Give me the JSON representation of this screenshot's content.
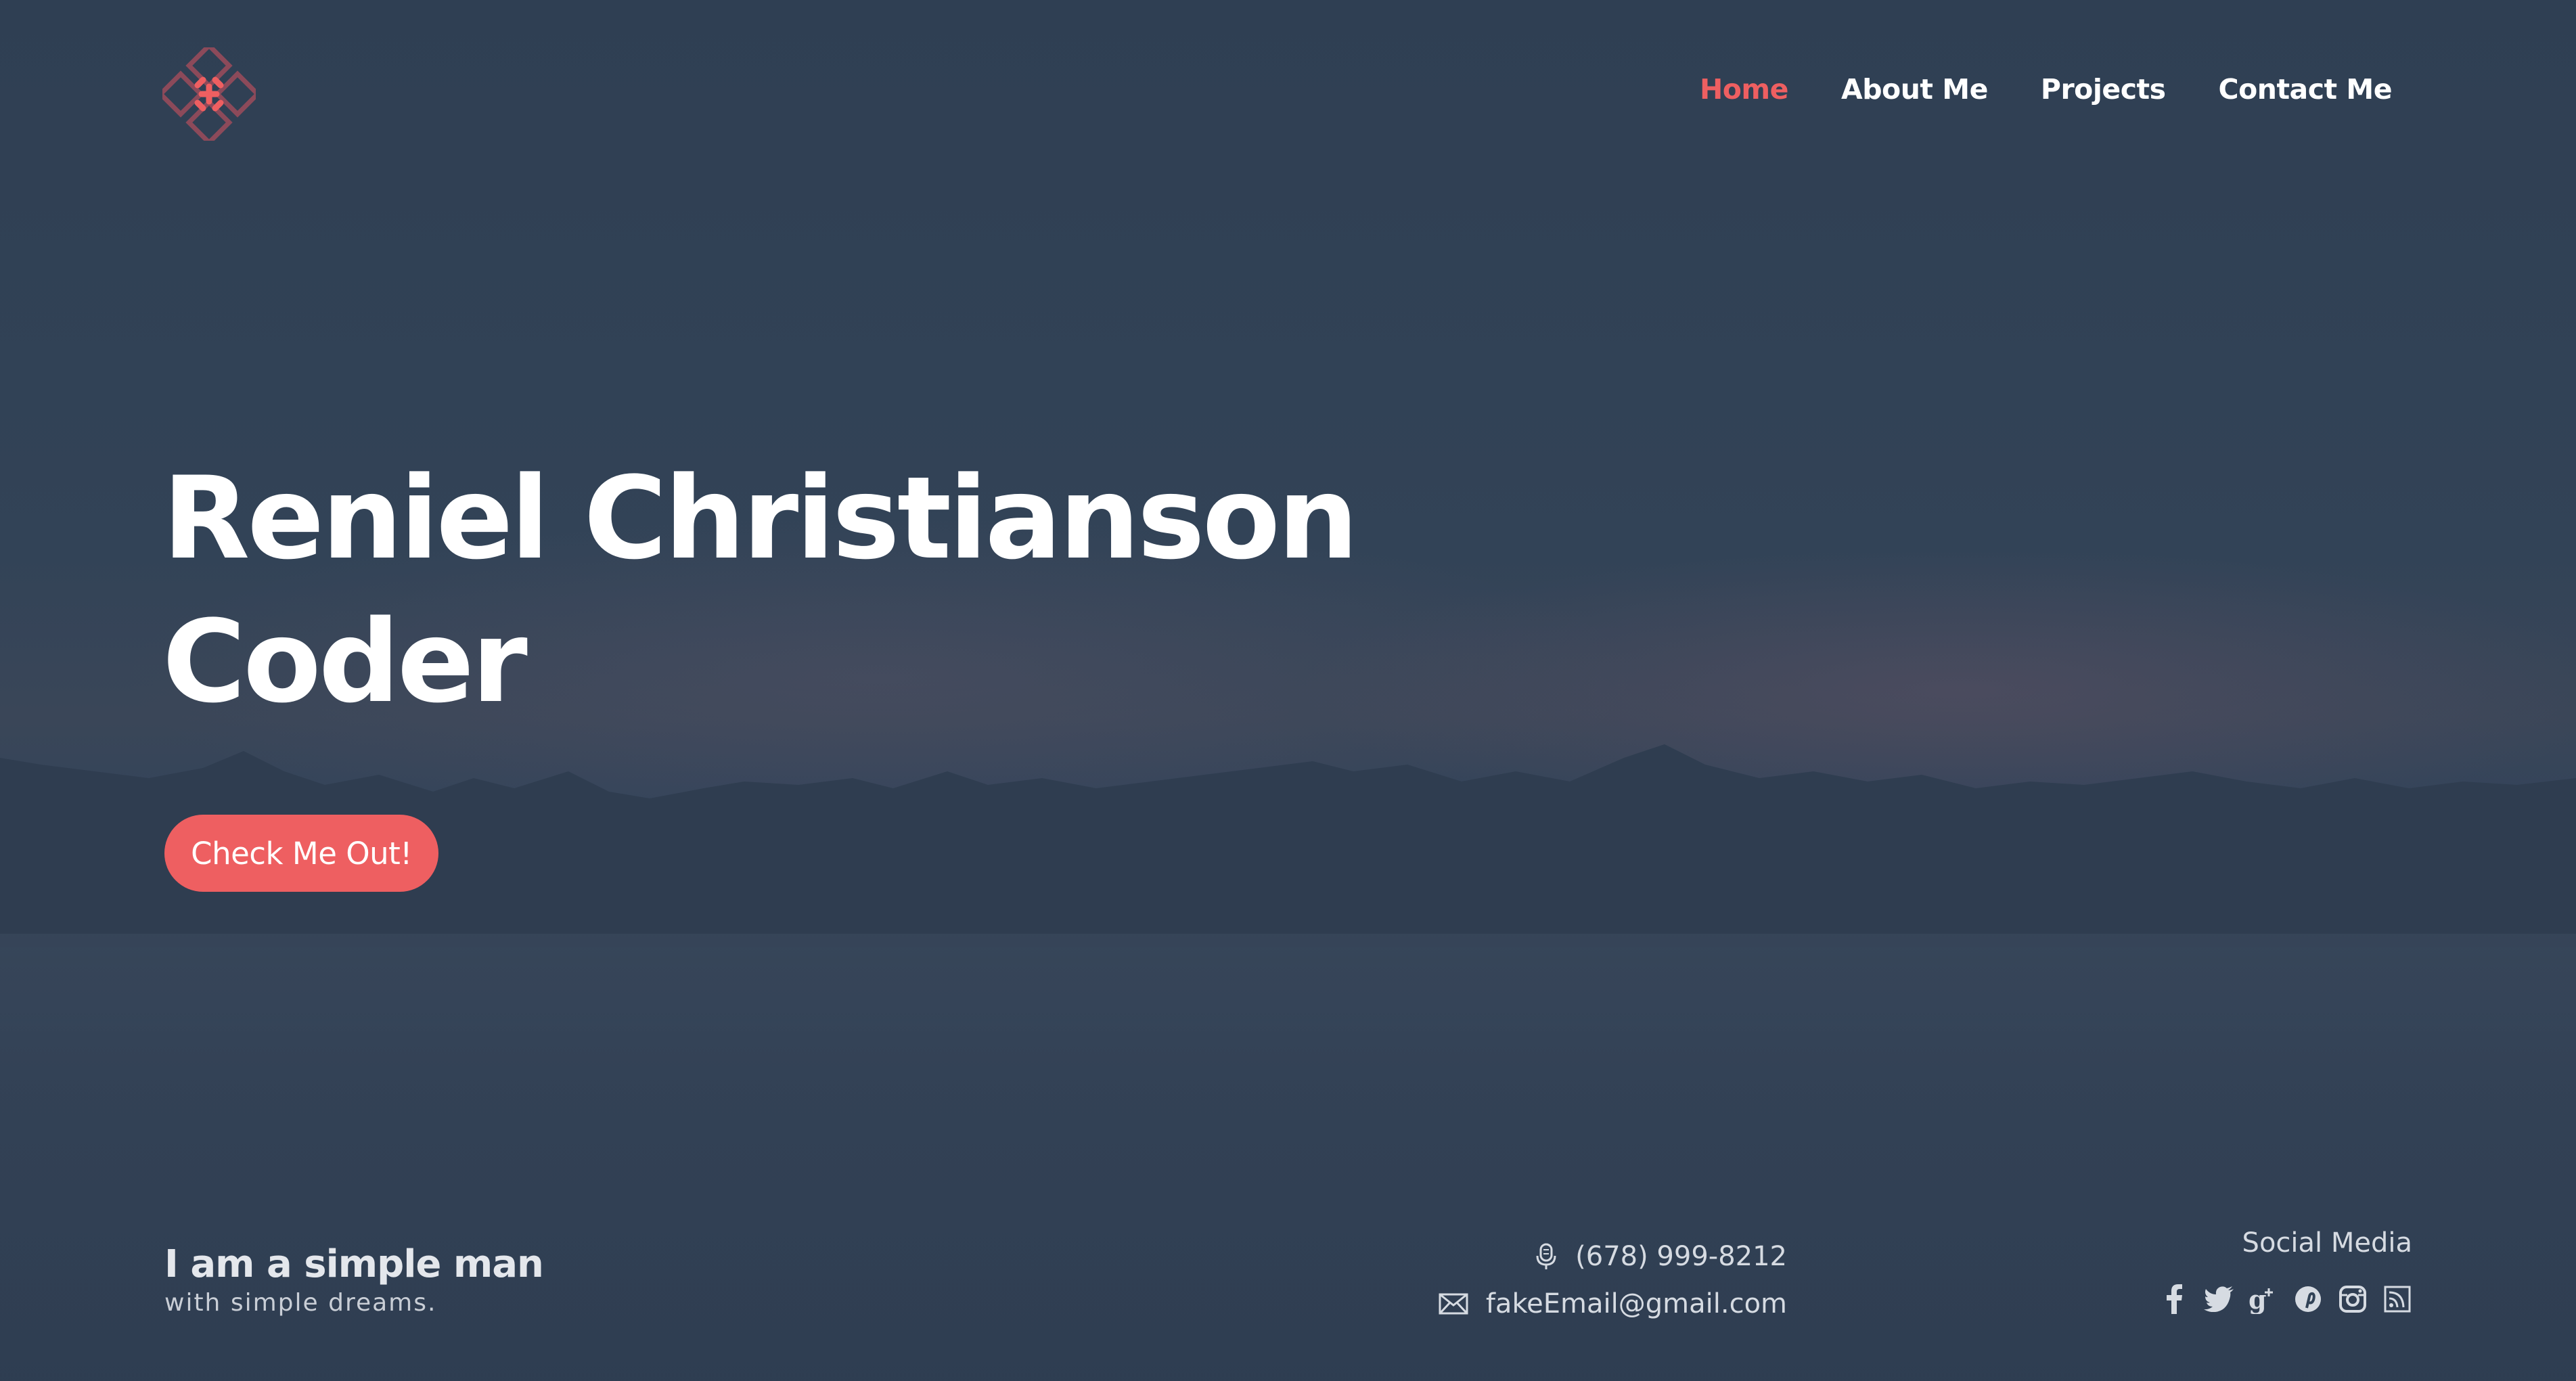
{
  "nav": {
    "items": [
      {
        "label": "Home",
        "active": true
      },
      {
        "label": "About Me",
        "active": false
      },
      {
        "label": "Projects",
        "active": false
      },
      {
        "label": "Contact Me",
        "active": false
      }
    ]
  },
  "hero": {
    "name": "Reniel Christianson",
    "role": "Coder",
    "cta_label": "Check Me Out!"
  },
  "footer": {
    "tagline": "I am a simple man",
    "subtagline": "with simple dreams.",
    "phone": "(678) 999-8212",
    "email": "fakeEmail@gmail.com",
    "social_label": "Social Media",
    "social_icons": [
      "facebook-icon",
      "twitter-icon",
      "google-plus-icon",
      "pinterest-icon",
      "instagram-icon",
      "rss-icon"
    ]
  },
  "colors": {
    "accent": "#ee5f61",
    "background": "#314256",
    "text": "#ffffff"
  }
}
